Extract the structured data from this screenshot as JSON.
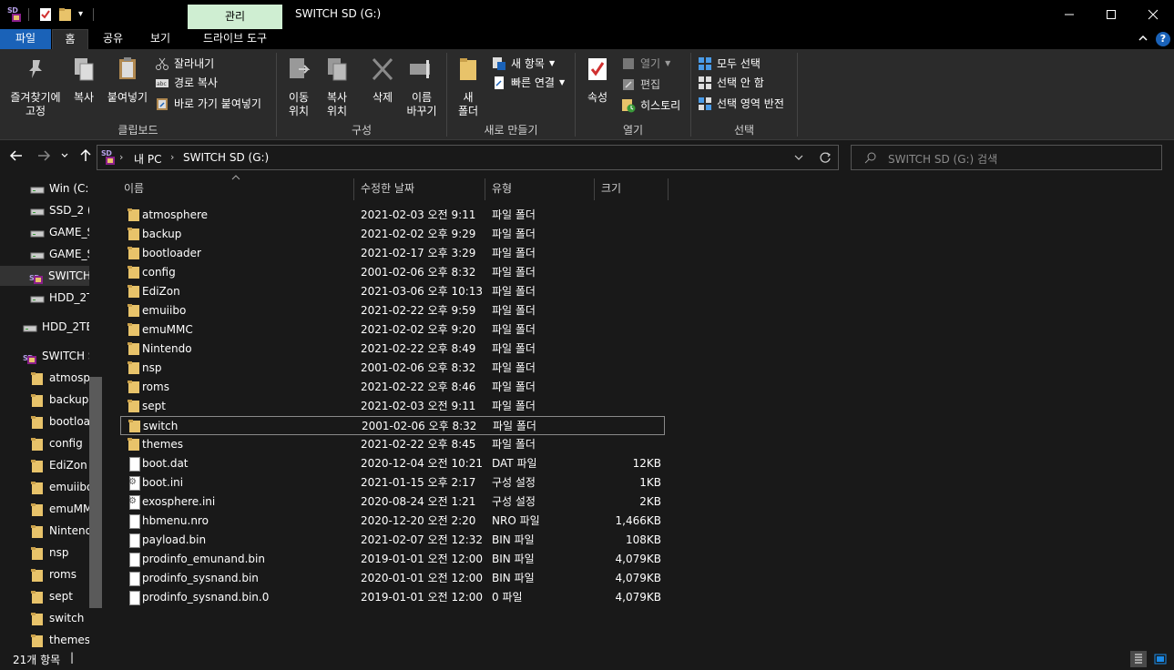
{
  "window": {
    "title": "SWITCH SD (G:)",
    "manage_tab": "관리",
    "minimize": "—",
    "maximize": "☐",
    "close": "✕"
  },
  "ribbon_tabs": {
    "file": "파일",
    "home": "홈",
    "share": "공유",
    "view": "보기",
    "drive_tools": "드라이브 도구"
  },
  "ribbon": {
    "clipboard": {
      "pin": "즐겨찾기에\n고정",
      "copy": "복사",
      "paste": "붙여넣기",
      "cut": "잘라내기",
      "copy_path": "경로 복사",
      "paste_shortcut": "바로 가기 붙여넣기",
      "label": "클립보드"
    },
    "organize": {
      "move_to": "이동\n위치",
      "copy_to": "복사\n위치",
      "delete": "삭제",
      "rename": "이름\n바꾸기",
      "label": "구성"
    },
    "new": {
      "new_folder": "새\n폴더",
      "new_item": "새 항목",
      "easy_access": "빠른 연결",
      "label": "새로 만들기"
    },
    "open": {
      "properties": "속성",
      "open": "열기",
      "edit": "편집",
      "history": "히스토리",
      "label": "열기"
    },
    "select": {
      "select_all": "모두 선택",
      "select_none": "선택 안 함",
      "invert": "선택 영역 반전",
      "label": "선택"
    }
  },
  "address": {
    "path": [
      "내 PC",
      "SWITCH SD (G:)"
    ],
    "search_placeholder": "SWITCH SD (G:) 검색"
  },
  "nav_pane": {
    "items": [
      {
        "label": "Win (C:)",
        "icon": "drive-icon"
      },
      {
        "label": "SSD_2 (",
        "icon": "drive-icon"
      },
      {
        "label": "GAME_S",
        "icon": "drive-icon"
      },
      {
        "label": "GAME_S",
        "icon": "drive-icon"
      },
      {
        "label": "SWITCH",
        "icon": "sd-drive-icon"
      },
      {
        "label": "HDD_2T",
        "icon": "drive-icon"
      },
      {
        "label": "HDD_2TB",
        "icon": "drive-icon"
      },
      {
        "label": "SWITCH S",
        "icon": "sd-drive-icon"
      },
      {
        "label": "atmosph",
        "icon": "folder-icon"
      },
      {
        "label": "backup",
        "icon": "folder-icon"
      },
      {
        "label": "bootload",
        "icon": "folder-icon"
      },
      {
        "label": "config",
        "icon": "folder-icon"
      },
      {
        "label": "EdiZon",
        "icon": "folder-icon"
      },
      {
        "label": "emuiibo",
        "icon": "folder-icon"
      },
      {
        "label": "emuMM",
        "icon": "folder-icon"
      },
      {
        "label": "Nintend",
        "icon": "folder-icon"
      },
      {
        "label": "nsp",
        "icon": "folder-icon"
      },
      {
        "label": "roms",
        "icon": "folder-icon"
      },
      {
        "label": "sept",
        "icon": "folder-icon"
      },
      {
        "label": "switch",
        "icon": "folder-icon"
      },
      {
        "label": "themes",
        "icon": "folder-icon"
      }
    ]
  },
  "columns": {
    "name": "이름",
    "date": "수정한 날짜",
    "type": "유형",
    "size": "크기"
  },
  "files": [
    {
      "name": "atmosphere",
      "date": "2021-02-03 오전 9:11",
      "type": "파일 폴더",
      "size": "",
      "icon": "folder-icon"
    },
    {
      "name": "backup",
      "date": "2021-02-02 오후 9:29",
      "type": "파일 폴더",
      "size": "",
      "icon": "folder-icon"
    },
    {
      "name": "bootloader",
      "date": "2021-02-17 오후 3:29",
      "type": "파일 폴더",
      "size": "",
      "icon": "folder-icon"
    },
    {
      "name": "config",
      "date": "2001-02-06 오후 8:32",
      "type": "파일 폴더",
      "size": "",
      "icon": "folder-icon"
    },
    {
      "name": "EdiZon",
      "date": "2021-03-06 오후 10:13",
      "type": "파일 폴더",
      "size": "",
      "icon": "folder-icon"
    },
    {
      "name": "emuiibo",
      "date": "2021-02-22 오후 9:59",
      "type": "파일 폴더",
      "size": "",
      "icon": "folder-icon"
    },
    {
      "name": "emuMMC",
      "date": "2021-02-02 오후 9:20",
      "type": "파일 폴더",
      "size": "",
      "icon": "folder-icon"
    },
    {
      "name": "Nintendo",
      "date": "2021-02-22 오후 8:49",
      "type": "파일 폴더",
      "size": "",
      "icon": "folder-icon"
    },
    {
      "name": "nsp",
      "date": "2001-02-06 오후 8:32",
      "type": "파일 폴더",
      "size": "",
      "icon": "folder-icon"
    },
    {
      "name": "roms",
      "date": "2021-02-22 오후 8:46",
      "type": "파일 폴더",
      "size": "",
      "icon": "folder-icon"
    },
    {
      "name": "sept",
      "date": "2021-02-03 오전 9:11",
      "type": "파일 폴더",
      "size": "",
      "icon": "folder-icon"
    },
    {
      "name": "switch",
      "date": "2001-02-06 오후 8:32",
      "type": "파일 폴더",
      "size": "",
      "icon": "folder-icon",
      "selected": true
    },
    {
      "name": "themes",
      "date": "2021-02-22 오후 8:45",
      "type": "파일 폴더",
      "size": "",
      "icon": "folder-icon"
    },
    {
      "name": "boot.dat",
      "date": "2020-12-04 오전 10:21",
      "type": "DAT 파일",
      "size": "12KB",
      "icon": "file-icon"
    },
    {
      "name": "boot.ini",
      "date": "2021-01-15 오후 2:17",
      "type": "구성 설정",
      "size": "1KB",
      "icon": "config-file-icon"
    },
    {
      "name": "exosphere.ini",
      "date": "2020-08-24 오전 1:21",
      "type": "구성 설정",
      "size": "2KB",
      "icon": "config-file-icon"
    },
    {
      "name": "hbmenu.nro",
      "date": "2020-12-20 오전 2:20",
      "type": "NRO 파일",
      "size": "1,466KB",
      "icon": "file-icon"
    },
    {
      "name": "payload.bin",
      "date": "2021-02-07 오전 12:32",
      "type": "BIN 파일",
      "size": "108KB",
      "icon": "file-icon"
    },
    {
      "name": "prodinfo_emunand.bin",
      "date": "2019-01-01 오전 12:00",
      "type": "BIN 파일",
      "size": "4,079KB",
      "icon": "file-icon"
    },
    {
      "name": "prodinfo_sysnand.bin",
      "date": "2020-01-01 오전 12:00",
      "type": "BIN 파일",
      "size": "4,079KB",
      "icon": "file-icon"
    },
    {
      "name": "prodinfo_sysnand.bin.0",
      "date": "2019-01-01 오전 12:00",
      "type": "0 파일",
      "size": "4,079KB",
      "icon": "file-icon"
    }
  ],
  "status": {
    "item_count": "21개 항목",
    "separator": "|"
  },
  "colors": {
    "accent": "#1a62b8",
    "manage_tab_bg": "#cfeed2",
    "folder": "#e8c36a",
    "background": "#191919"
  }
}
